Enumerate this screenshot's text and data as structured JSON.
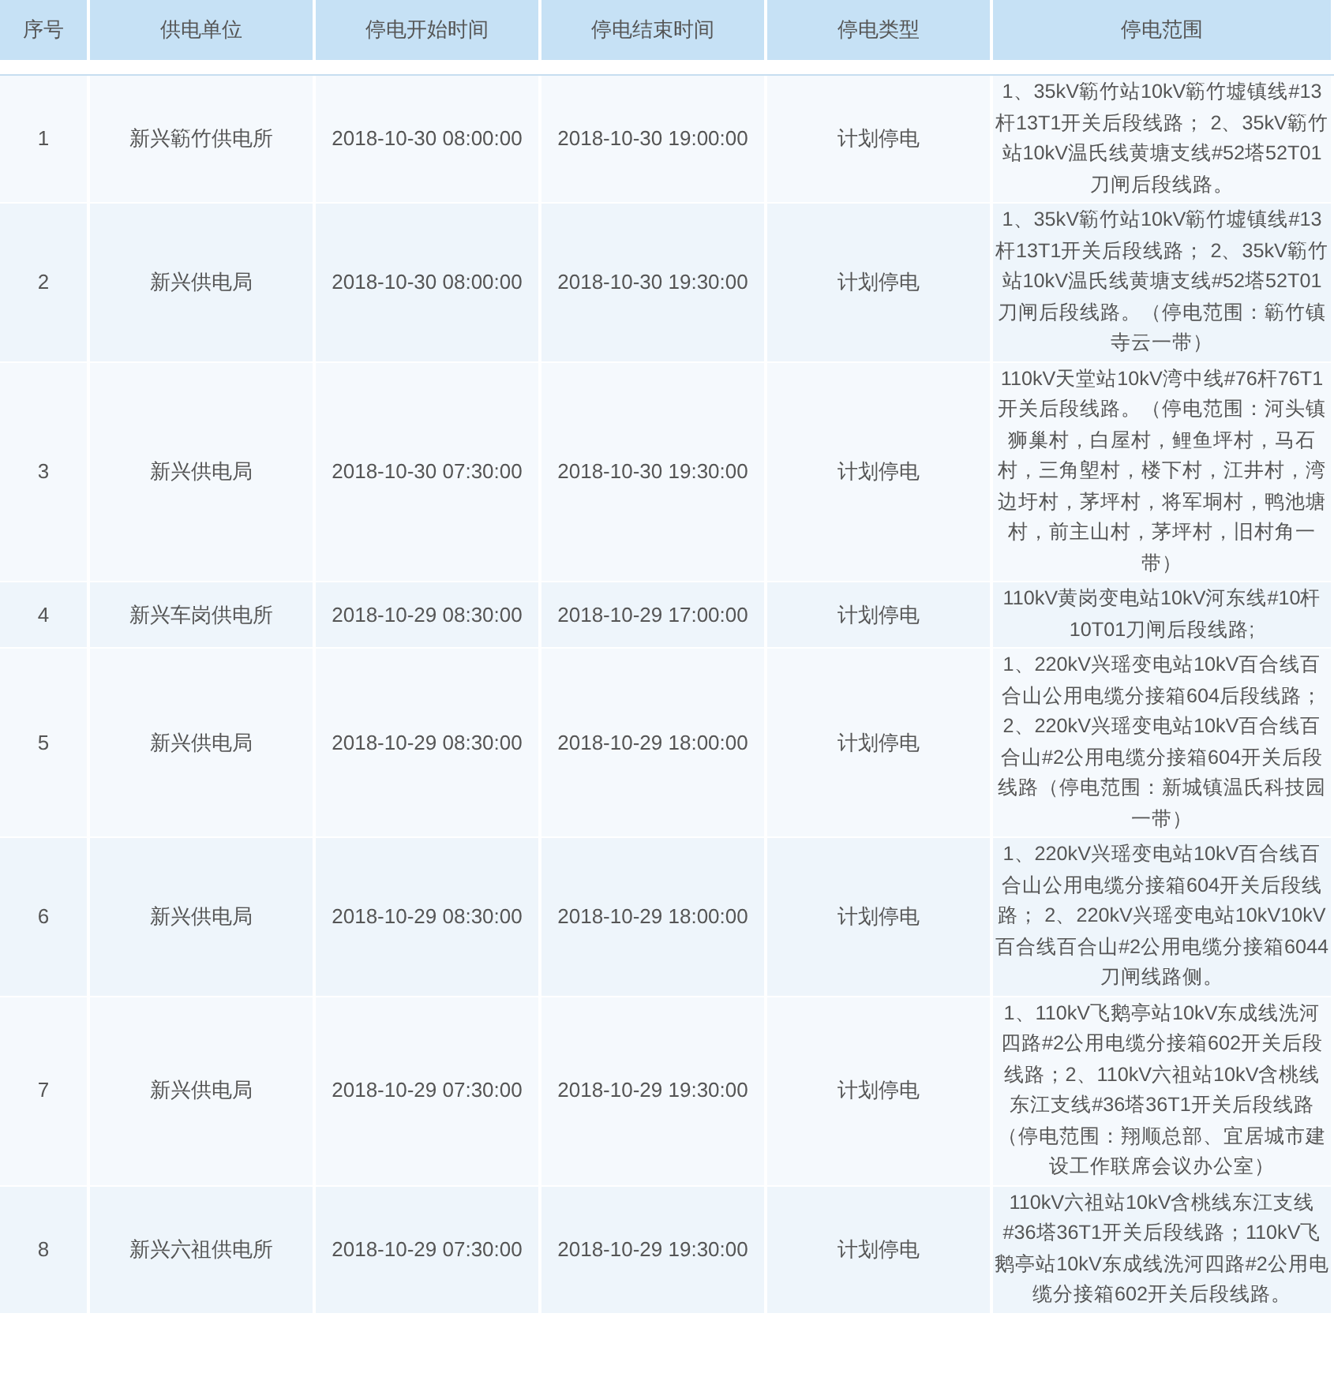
{
  "table": {
    "columns": [
      "序号",
      "供电单位",
      "停电开始时间",
      "停电结束时间",
      "停电类型",
      "停电范围"
    ],
    "rows": [
      {
        "cells": [
          "1",
          "新兴簕竹供电所",
          "2018-10-30 08:00:00",
          "2018-10-30 19:00:00",
          "计划停电",
          "1、35kV簕竹站10kV簕竹墟镇线#13杆13T1开关后段线路； 2、35kV簕竹站10kV温氏线黄塘支线#52塔52T01刀闸后段线路。"
        ]
      },
      {
        "cells": [
          "2",
          "新兴供电局",
          "2018-10-30 08:00:00",
          "2018-10-30 19:30:00",
          "计划停电",
          "1、35kV簕竹站10kV簕竹墟镇线#13杆13T1开关后段线路； 2、35kV簕竹站10kV温氏线黄塘支线#52塔52T01刀闸后段线路。（停电范围：簕竹镇寺云一带）"
        ]
      },
      {
        "cells": [
          "3",
          "新兴供电局",
          "2018-10-30 07:30:00",
          "2018-10-30 19:30:00",
          "计划停电",
          "110kV天堂站10kV湾中线#76杆76T1开关后段线路。（停电范围：河头镇狮巢村，白屋村，鲤鱼坪村，马石村，三角塱村，楼下村，江井村，湾边圩村，茅坪村，将军垌村，鸭池塘村，前主山村，茅坪村，旧村角一带）"
        ]
      },
      {
        "cells": [
          "4",
          "新兴车岗供电所",
          "2018-10-29 08:30:00",
          "2018-10-29 17:00:00",
          "计划停电",
          "110kV黄岗变电站10kV河东线#10杆10T01刀闸后段线路;"
        ]
      },
      {
        "cells": [
          "5",
          "新兴供电局",
          "2018-10-29 08:30:00",
          "2018-10-29 18:00:00",
          "计划停电",
          "1、220kV兴瑶变电站10kV百合线百合山公用电缆分接箱604后段线路； 2、220kV兴瑶变电站10kV百合线百合山#2公用电缆分接箱604开关后段线路（停电范围：新城镇温氏科技园一带）"
        ]
      },
      {
        "cells": [
          "6",
          "新兴供电局",
          "2018-10-29 08:30:00",
          "2018-10-29 18:00:00",
          "计划停电",
          "1、220kV兴瑶变电站10kV百合线百合山公用电缆分接箱604开关后段线路； 2、220kV兴瑶变电站10kV10kV百合线百合山#2公用电缆分接箱6044刀闸线路侧。"
        ]
      },
      {
        "cells": [
          "7",
          "新兴供电局",
          "2018-10-29 07:30:00",
          "2018-10-29 19:30:00",
          "计划停电",
          "1、110kV飞鹅亭站10kV东成线洗河四路#2公用电缆分接箱602开关后段线路；2、110kV六祖站10kV含桃线东江支线#36塔36T1开关后段线路（停电范围：翔顺总部、宜居城市建设工作联席会议办公室）"
        ]
      },
      {
        "cells": [
          "8",
          "新兴六祖供电所",
          "2018-10-29 07:30:00",
          "2018-10-29 19:30:00",
          "计划停电",
          "110kV六祖站10kV含桃线东江支线#36塔36T1开关后段线路；110kV飞鹅亭站10kV东成线洗河四路#2公用电缆分接箱602开关后段线路。"
        ]
      }
    ]
  }
}
